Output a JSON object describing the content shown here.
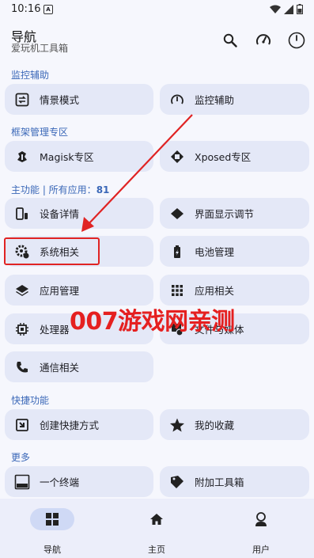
{
  "status": {
    "time": "10:16",
    "notif_letter": "A"
  },
  "header": {
    "title": "导航",
    "subtitle": "爱玩机工具箱"
  },
  "sections": {
    "monitor": "监控辅助",
    "framework": "框架管理专区",
    "main_prefix": "主功能 | 所有应用：",
    "main_count": "81",
    "shortcuts": "快捷功能",
    "more": "更多"
  },
  "cards": {
    "scene_mode": "情景模式",
    "monitor_assist": "监控辅助",
    "magisk": "Magisk专区",
    "xposed": "Xposed专区",
    "device_info": "设备详情",
    "display_adjust": "界面显示调节",
    "system": "系统相关",
    "battery": "电池管理",
    "app_manage": "应用管理",
    "app_related": "应用相关",
    "processor": "处理器",
    "file_media": "文件与媒体",
    "comm": "通信相关",
    "create_shortcut": "创建快捷方式",
    "favorites": "我的收藏",
    "terminal": "一个终端",
    "extra_tools": "附加工具箱"
  },
  "watermark": "007游戏网亲测",
  "nav": {
    "nav": "导航",
    "home": "主页",
    "user": "用户"
  },
  "colors": {
    "accent": "#3b68b8",
    "card_bg": "#e4e8f7",
    "annotation_red": "#e02323"
  }
}
